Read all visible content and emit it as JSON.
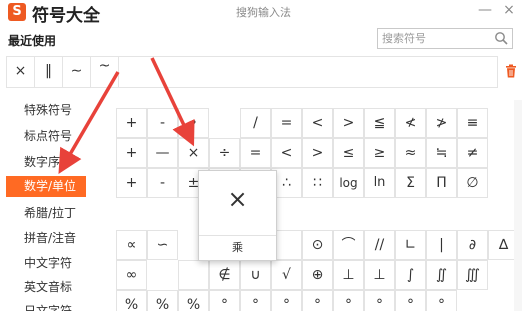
{
  "titlebar": {
    "logo_glyph": "S",
    "app_title": "符号大全",
    "ime_name": "搜狗输入法",
    "minimize_glyph": "—",
    "close_glyph": "×"
  },
  "recent": {
    "label": "最近使用",
    "symbols": [
      "×",
      "‖",
      "∼",
      "~"
    ]
  },
  "search": {
    "placeholder": "搜索符号",
    "value": ""
  },
  "sidebar": {
    "items": [
      {
        "label": "特殊符号"
      },
      {
        "label": "标点符号"
      },
      {
        "label": "数字序号"
      },
      {
        "label": "数学/单位"
      },
      {
        "label": "希腊/拉丁"
      },
      {
        "label": "拼音/注音"
      },
      {
        "label": "中文字符"
      },
      {
        "label": "英文音标"
      },
      {
        "label": "日文字符"
      }
    ],
    "active_index": 3
  },
  "symbol_grid": {
    "rows": [
      [
        "+",
        "-",
        "•",
        "/",
        "=",
        "<",
        ">",
        "≦",
        "≮",
        "≯",
        "≡"
      ],
      [
        "+",
        "—",
        "×",
        "÷",
        "=",
        "<",
        ">",
        "≤",
        "≥",
        "≈",
        "≒",
        "≠"
      ],
      [
        "+",
        "-",
        "±",
        "",
        "",
        "∴",
        "∷",
        "log",
        "ln",
        "Σ",
        "Π",
        "∅"
      ],
      [
        "∝",
        "∽",
        "",
        "",
        "⊙",
        "⌒",
        "//",
        "∟",
        "|",
        "∂",
        "∆"
      ],
      [
        "∞",
        "",
        "∉",
        "∪",
        "√",
        "⊕",
        "⊥",
        "⊥",
        "∫",
        "∬",
        "∭"
      ],
      [
        "%",
        "%",
        "%",
        "°",
        "°",
        "°",
        "°",
        "°",
        "°",
        "°",
        "°"
      ]
    ]
  },
  "popup": {
    "symbol": "×",
    "name": "乘"
  },
  "colors": {
    "accent": "#ff6a23",
    "arrow": "#e8423a"
  }
}
